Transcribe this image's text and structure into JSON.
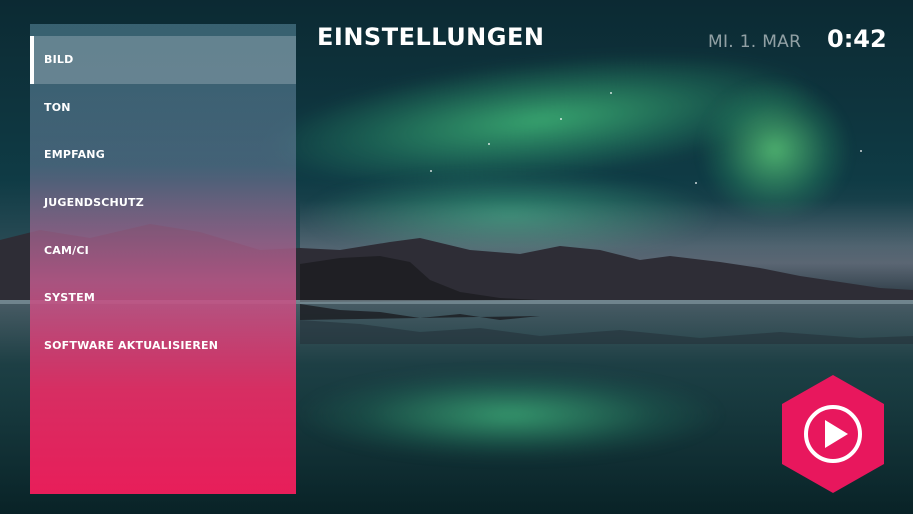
{
  "header": {
    "title": "EINSTELLUNGEN",
    "date": "MI. 1. MAR",
    "time": "0:42"
  },
  "menu": {
    "items": [
      {
        "label": "BILD",
        "active": true
      },
      {
        "label": "TON",
        "active": false
      },
      {
        "label": "EMPFANG",
        "active": false
      },
      {
        "label": "JUGENDSCHUTZ",
        "active": false
      },
      {
        "label": "CAM/CI",
        "active": false
      },
      {
        "label": "SYSTEM",
        "active": false
      },
      {
        "label": "SOFTWARE AKTUALISIEREN",
        "active": false
      }
    ]
  },
  "play_button": {
    "icon": "play-icon"
  },
  "colors": {
    "accent": "#e8175d",
    "text": "#ffffff",
    "date_text": "#a9b6bb"
  }
}
